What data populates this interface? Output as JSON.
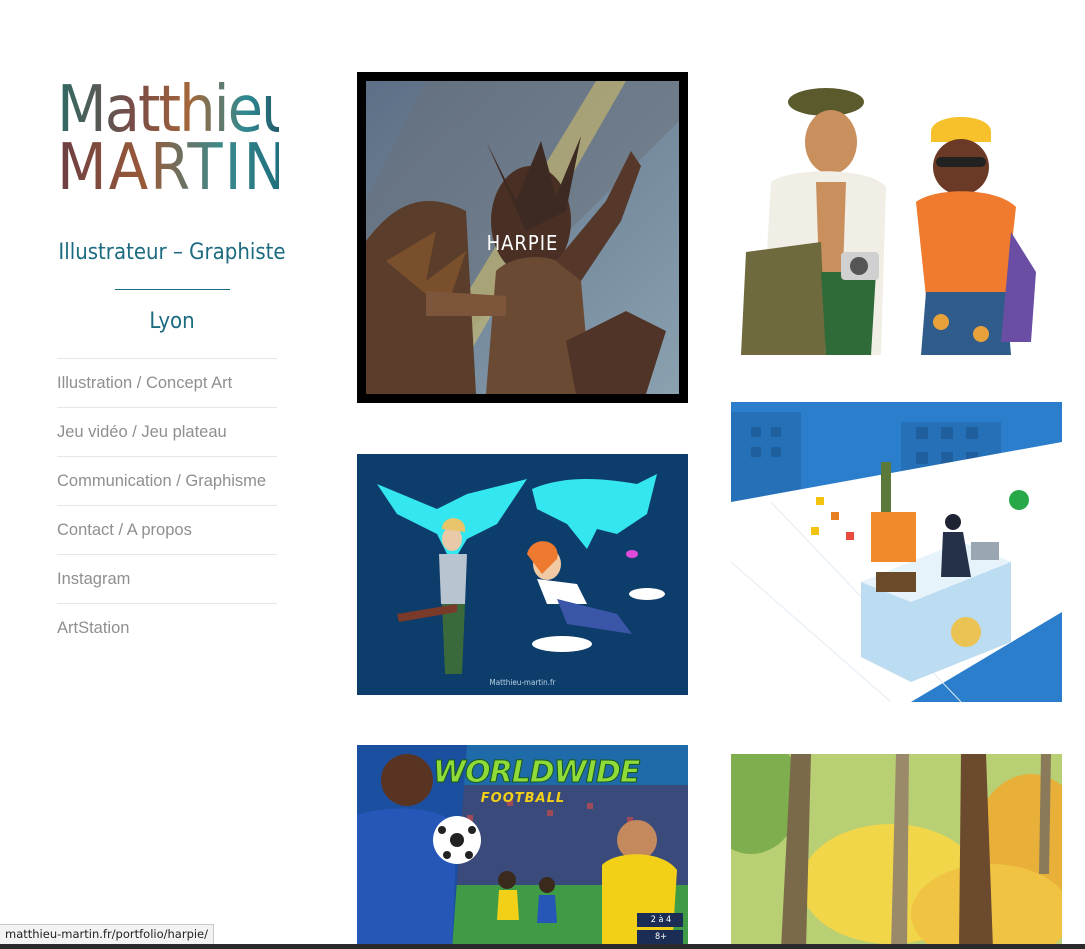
{
  "logo": {
    "first_name": "Matthieu",
    "last_name": "MARTIN"
  },
  "tagline": "Illustrateur – Graphiste",
  "city": "Lyon",
  "nav": {
    "items": [
      {
        "label": "Illustration / Concept Art"
      },
      {
        "label": "Jeu vidéo / Jeu plateau"
      },
      {
        "label": "Communication / Graphisme"
      },
      {
        "label": "Contact / A propos"
      },
      {
        "label": "Instagram"
      },
      {
        "label": "ArtStation"
      }
    ]
  },
  "portfolio": {
    "harpie": {
      "caption": "HARPIE"
    },
    "dragons": {
      "watermark": "Matthieu-martin.fr"
    },
    "football": {
      "title_line1": "WORLDWIDE",
      "title_line2": "FOOTBALL",
      "badge1": "2 à 4",
      "badge2": "8+"
    }
  },
  "status_url": "matthieu-martin.fr/portfolio/harpie/",
  "colors": {
    "accent": "#1c6b80",
    "nav_text": "#8f8f8f"
  }
}
